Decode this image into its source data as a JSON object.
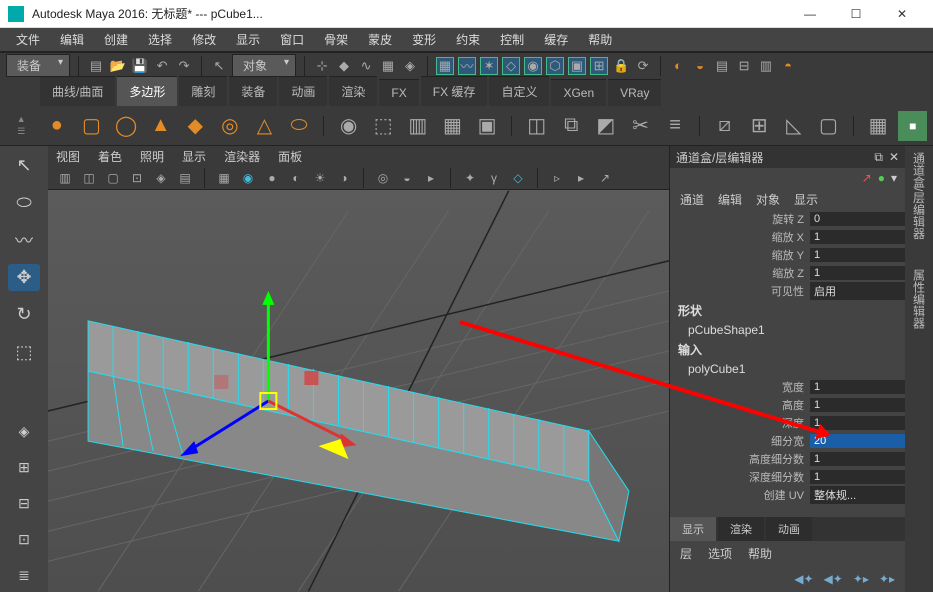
{
  "window": {
    "title": "Autodesk Maya 2016: 无标题*  ---   pCube1...",
    "minimize": "—",
    "maximize": "☐",
    "close": "✕"
  },
  "menubar": [
    "文件",
    "编辑",
    "创建",
    "选择",
    "修改",
    "显示",
    "窗口",
    "骨架",
    "蒙皮",
    "变形",
    "约束",
    "控制",
    "缓存",
    "帮助"
  ],
  "status": {
    "mode": "装备",
    "snap_mode": "对象"
  },
  "shelf_tabs": [
    "曲线/曲面",
    "多边形",
    "雕刻",
    "装备",
    "动画",
    "渲染",
    "FX",
    "FX 缓存",
    "自定义",
    "XGen",
    "VRay"
  ],
  "shelf_active": 1,
  "viewport_menu": [
    "视图",
    "着色",
    "照明",
    "显示",
    "渲染器",
    "面板"
  ],
  "channel_box": {
    "title": "通道盒/层编辑器",
    "menu": [
      "通道",
      "编辑",
      "对象",
      "显示"
    ],
    "rows": [
      {
        "lbl": "旋转 Z",
        "val": "0"
      },
      {
        "lbl": "缩放 X",
        "val": "1"
      },
      {
        "lbl": "缩放 Y",
        "val": "1"
      },
      {
        "lbl": "缩放 Z",
        "val": "1"
      },
      {
        "lbl": "可见性",
        "val": "启用"
      }
    ],
    "shape_h": "形状",
    "shape": "pCubeShape1",
    "input_h": "输入",
    "input": "polyCube1",
    "input_rows": [
      {
        "lbl": "宽度",
        "val": "1"
      },
      {
        "lbl": "高度",
        "val": "1"
      },
      {
        "lbl": "深度",
        "val": "1"
      },
      {
        "lbl": "细分宽",
        "val": "20",
        "sel": true
      },
      {
        "lbl": "高度细分数",
        "val": "1"
      },
      {
        "lbl": "深度细分数",
        "val": "1"
      },
      {
        "lbl": "创建 UV",
        "val": "整体规..."
      }
    ],
    "layer_tabs": [
      "显示",
      "渲染",
      "动画"
    ],
    "layer_menu": [
      "层",
      "选项",
      "帮助"
    ]
  },
  "far_right": [
    "通道盒/层编辑器",
    "属性编辑器"
  ]
}
